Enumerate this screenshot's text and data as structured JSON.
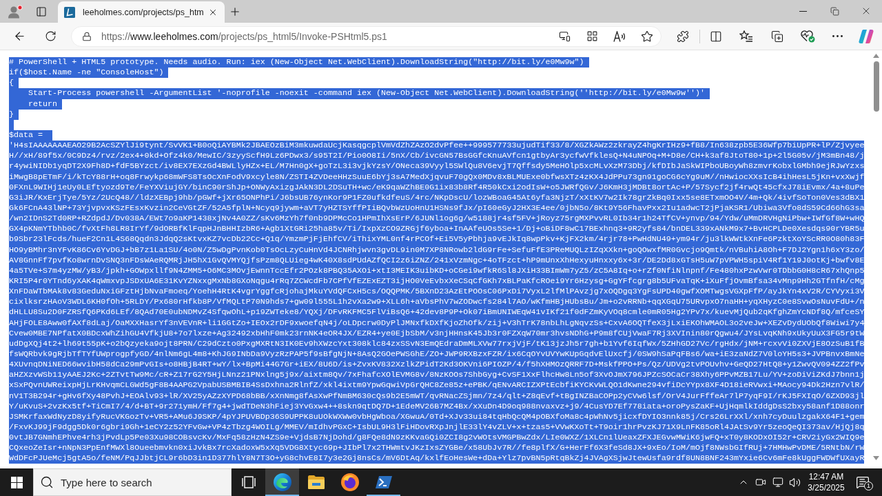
{
  "browser": {
    "tabs": [
      {
        "title": "leeholmes.com/projects/ps_htm",
        "selected": true
      }
    ],
    "address_bar": {
      "scheme": "https://",
      "host": "www.leeholmes.com",
      "path": "/projects/ps_html5/Invoke-PSHtml5.ps1"
    }
  },
  "script": {
    "selected": true,
    "header_lines": [
      "# PowerShell + HTML5 prototype. Needs audio. Run: iex (New-Object Net.WebClient).DownloadString(\"http://bit.ly/e0Mw9w\")",
      "if($host.Name -ne \"ConsoleHost\")",
      "{",
      "    Start-Process powershell -ArgumentList '-noprofile -noexit -command iex (New-Object Net.WebClient).DownloadString(''http://bit.ly/e0Mw9w'')'",
      "    return",
      "}"
    ],
    "assignment": "$data = ",
    "data_lines": [
      "'H4sIAAAAAAAEAO29B2AcSZYlJi9tynt/SvVK1+B0oQiAYBMk2JBAEOzBiM3mkuwdaUcjKasqgcplVmVdZhZAzO2dvPfee++999577733ujudTif33/8/XGZkAWz2zkrayZ4hgKrIHz9+fB8/In638zpb5E36Wfp7biUpPR+lP/Zjvyee",
      "H//xH/89f5x/0C9Dz4/rvz/2ex4+0kd+Ofz4k0/MewIC/3zyyScfH9Lz6PDwx3/s95T2I/Pio0O8Ii/5nX/Cb/ivcGN57BsGGfcKnuAVfcn1gtbyAr3ycfwVfklesQ+N4uNPOq+M+D8e/CH+k3af8JtoT80+1p+2l5G05v/jM3mBn48/j",
      "r4ywiNIDb1yqDT2X9Fh8D+fdF5BYzct/iv8EX7EXzGd4BWLlyHZx+EL/M7Hn0gX+goTzL3i3vjkYzsY/ONeca39Vyyl5SWlQu8V6evjT7Qffsdy5MeHOlp5xcMLvXzM73Dbj/kfDIbJaSkWIPboUBoyWh8zmvrKobxlGMbh9ejRJwYzxs",
      "iMwgB8pETmF/i/kTcY88rH+oq8Frwykp68mWFS8TsOcXnFodV9xcyle8N/ZSTI4ZVDeeHHzSuuE6bYj3sA7MedXjqvuF70gQx0MDv8xBLMUExe0bfwsXTz4zKX4JdPPu73gn91goCG6cYg9uM//nHwiocXXsIcB4ihHesL5jKn+vxXwjf",
      "0FXnL9WIHj1eUy0LEftyozd9Te/FeYXViujGY/binC90rShJp+ONWyAxizgJAkN3DL2DSuTH+wc/eK9qaWZhBE0G1ix83b8Rf4R50kCxi2odIsW+o5JWRfQGv/J6KmH3jMDBt8ortAc+P/57Sycf2jf4rwQt45cfxJ78iEvmx/4a+8uPe",
      "G3iJR/KxErjTye/5Yz/2UcQ48//ldzXEBpj9hb/pGWf+jXr65ONPhPi/J6bsUB76ynKor9P1FZ0ufkdfeuS/4rc/NKpDscU/lozWBoaG45At6yfa3NjzT/xXtKV7w2Ik78grZkBq0Ixx5se8ETxmOO4V/4m+Qk/4ivfSoTon0Ves3dBX1",
      "Gk6FCnA43lNP+73YjvpvxKSzFEsxKvzin2CeVGtZF/52A5fplN+Ncyq9jywm+aVT7yHZTSYffPIiBQvbWzUoHnU1HSNs9fJx/pI60eGyJ2HX3E4ee/0jbN5o/8Kt9Y56FhavPxx2Iu1adwcT2jPjaKSR1/Ubiwa3Vfo8dS59Cd66hG3sa",
      "/wn2IDnS2Td0RP+RZdpdJ/Dv038A/EWt7o9aKP1438xjNv4A0ZZ/sKv6MzYh7f0nb9DPMcCo1HPmIhXsErP/6JUNl1og6g/w5188jr4sf5FV+jRoyz75rgMXPvvRL0Ib34r1h24TfCV+ynvp/94/Ydw/uMmDRVHgNiPbw+IWfGf8W+wHQ",
      "GX4pKNmYTbhb0C/fvXtFh8LR8IrYf/9dORBfKlFqpHJnBHHIzbR6+Agb1XtGRi25ha85v/Ti/IxpXzCO9ZRGjf6yboa+InAAfeUOs5Se+1/Dj+oBiDF8wC17BExhnq3+9R2yfs84/bnDEL339xANkM9x7+BvHCPLDe0Xesdqs90rYBR5u",
      "b9Sbr23lFcds/hueF2Cn1L4S68Qqdn3JdqQ2sKtvxKZ7vcDb22Cc+Q1q/YmzmPjFjEhfCV/iThixYML0nf4rPCOf+Ei5V5yPbhja9vEJkIq8wpPkv+KjFX2km/4rjr78+PwHdNU49+ym94r/ju3lkWWtkXnFe6PzktXoYScRR0O80h83F",
      "HO9yBMhr3nYFvK86Cv6YvDGJ+bB7z1La1SU/4o0N/Z5wDgPvnKob0TsOcLzyCuHnVd4JCNRhjwvn3gvDL9in0M7XP8NRowb2ldG9rFe+SefuFfE3PReMUQLzIZqXXkn+goQOwxfMR0Gvcjo9Qmtk/nVBuhiA8Oh+F7DJ2Ygn1h6xY3zo/",
      "AV8GnnFf7pvfKo8wrnDvSNQ3nFDsWAeRQMRjJH5hX1GvQVMYQjfsPzm8QLUieg4wK40X8sdPUdAZfQCI2z6iZNZ/241xVzmNgc+4oTFzct+hP9mUnxXhHexyuHnxxy6x+3r/DE2Dd8xGTsH5uW7pVPWH5spiV4Rf1Y19J0otKj+bwfv8E",
      "4a5TVe+S7m4yzMW/yB3/jpkh+GOWpxllf9N4ZMM5+O6MC3MOvjEwnnTccEfr2POzk8PBQ35AXOi+xtI3MEIK3uibKD+oCGei9wfkR6Sl8JXiH33BImWm7yZ5/zC5A8Iq+o+rZf0NfiNlnpnf/Fe480hxPzwVwr0TDbbG0H8cR67xhQnp5",
      "KRI5P4r0YTnd6yXAK4qWmxvpJSDxUA6E31KvYZNxxgMxNb8GXoNqgu4rRq7ZCWcdFb7CPfVfEZExEZT3ijHO0VeEvbxXeCSqCfGKh7xBLPaKfcROei9Yr6Hzysg+GgYFfcgrg8b5UFvaTqK+iXuFfjOvmBfsa34vMnp9Hh2GTfnfH/cMg",
      "XnFDaWTbMAk8v83GeduNxiGFztHjbNvaFmoeq/YoehH4RtK4vgrYggfcRjohajMkuYVdQFCxH5cs/OQQPMK/5BXnD23AzEtPOOsC06PxDi7VyxL2lfMlPAvzjg7xOQDgq3YgFsUPD40gwfXOMTwgsVGXpFfP/ayJkYn4xV2R/CYVyxi3V",
      "cixlksrzHAoV3WDL6KH0fOh+5RLDY/Px680rHfkb8P/VfMQLtP70N9hds7+gw09l555L1h2vXa2w9+XLL6h+aVbsPhV7wZODwcfs284l7AO/wKfmHBjHUbsBu/Jm+o2vRRNb+qqXGqU75URvpxO7naHH+yqXHyzC0e8SvwOsNuvFdU+/n",
      "dHLLU8Su2D0FZRSfQ6PKd6LEf/8QAd70E0ubNDMvZ4SfqwOhL+p19ZWTeke8/YQXj/DFvRKFMC5FlViBsQ6+42dev8P9P+Ok07iBmUNIWEqW41vIKf21f0dFZmKyVOq8cmle0mR05Hg2YPv7x/kuevMjQub2qKfghZmYcNDf8Q/mfceSY",
      "AHjFOLE8Aww0fAXf8dLaj/OaMXXHasrYf3nVEVnR+li1GGtZo+IEOx2rDF9xwoefqN4j/oLDpcrw0DyPlJMNxfkDXfKjoZhOfk/zij+V3hTrK78nbLhLgNqvzSs+CxvA6OQTfeX3jLxiEKOhWMAOL3o2veJw+XEZvDydUObQf8Wiwi7y4",
      "Cvew0MBE7NPfatX0BDcxWhZihGU4VfkjU8+7o7lxze+Ag32492xbHhF0mk23rnNK4eOR4JX/EZR4+ye0EjbSbM/v3njHHnsK45Jb3r0FZXqW70mr3hvsNDhG+P9m8fCUjVwaF7Rj3XVInin80rQgwu4/JYsLvqKNh9xUkyUuX3FG5r9tW",
      "udDgXQj4t2+lh69t55pK+o2bQzyeka9ojt8PRN/C29dCzto0PxgMXRtN3IK0Ev9hXWzcYxt308klc84zxSSvN3EmQEdraDmMLXVw77rxjVjF/tK13jzJh5r7gh+b1Yvf6IqfWx/5ZHhGD27Vc/rgHdx/jNM+rcxvVi0ZXVjE8OzSuB1fB",
      "fsWQRbvk9gRjbTfTYfUWprogpfyGD/4nlNm6gL4m8+KhJG9INbDa9VyzRzPAP5f9sBfgNjN+8AsQ2GOePWSGhE/ZO+JWP9RXBzxFZR/ix6CqOYvUVYwKUpGqdvElUxcfj/0SW9hSaPqFBs6/wa+iE3zaNdZ7V0loYH5s3+JVPBnvxBmNe",
      "4XUvnqDNiNED66wvibH58dCa29mPvGIs+o8HBjB4RT+wY/lx+BpMi44G7Gr+iEX/8U6D/is+ZvxKV832XzlkZPidT2Kd3OKVni6PIOZP/4/f5hXHMOzQRRF7D+MskfPPO+Ps/Qz/UDVg2tvPOUvhv+GeQD27HtQ8+y1ZwvQV094ZZ2fPv",
      "aHZXzvWSb11yAAEJ2Kc+2ZTvtTw9Mc/cR+Z17rG2Y5HjLNnz21PNxlng5j9x/aixtm8Qv/7xFhafcXOlEVMG8v/8NzKOOs7ShbGyg+CvSF1XxFlhcHw8Ln5of3XvOJmX796JPZcSOCaCr38Xhy6PPvMZB17Lu/YV+zoDiViZKdJ7bnn1j",
      "xSxPQvnUWReixpHjLrKHvqmCLGWd5gF8B4AAPG2VpabUSBMBIB4SsDxhna2RlnfZ/xkl4ixtm9YpwGqwiVpGrQHC8Ze85z+ePBK/qENvARCIZXPtEcbfiKYCKvWLQO1dKwne294vfiDcYYpx8XF4D18ieRVwxi+MAocy94Dk2Hzn7vlR/",
      "nV1T3B294r+gHv6fXy48PvhJ+EOAlv93+lR/XV25yAZzXYPD68bBB/xXnNmg8fAsXwPfNmBM630cQs9b2E5mWT/qvRNacZSjmn/7z4/qlt+Z8qEvf+tBgINZBaCOPp2yCVw6lsf/OrV4JurFffeAr7lP7yqF9I/rKJ5FXIqO/6ZXD93jl",
      "Y/uKvuS+2vzKx5tf+TiCmI7/4/d+BT+9r271ymH/Ff7g4+jwdTDeN3hFiej3YvGxw4++8skn9qtDQ7D+1EdeMV26B7MZ4Bx/xXuDn4D9oq988nvaxvz+j9/4CusYD7Ef778iata+oroPysZaKF+UjHqmlkIddgDsS2bxy58anf1D88onr",
      "JSMKrfaxWdNyzD8yifyRucVKGozTv+VR5+AMu6J9SKP/4pYJPUVBDp36S9UPPK8uUOkWXWw0vbHgWboa/XGwuA/0Td+XJv33ui84tqHbQcQM4pOBXfoMa8c4pWhNv5jicxfDYIO3nnk85j/Crs26LrXXl/xnh7cyDuulzgakX64F1+gem",
      "/FxvKJ99jF9dgg5Dk0r6gbri9Gh+1eCY2z52YFvGw+VP4zTbzg4WOILg/MMEV/mIdhvPGxC+IsbUL9H3lFiHDovRXpJnjlE33lY4vZLV+x+tzas5+VVwKXoTt+T9oir1hrPvzKJ71X9LnFK85oRl4JAtSv9Yr5zeoQeQI373av/HjQj8q",
      "0vtJB7GNmhEPhve4rh3jPvdLp5Pe03Xu98COBsvcKv/MxFq58zHzN4ZS9e+VjdsB7NjDohd/g8FQe8dN9zKKvaGQi0ZCI8g2vWOtsVMGPBwZdx/LIe0WXZ/1XLCn1lUeaxZFXJEGvwMWiK6jwFQ+xT0y8KODxOI52r+CRV2iyGx2WIQ9e",
      "CQxeoZeIsr+nNpN3PpEnfMWXl8Oueebmvkn0xiJvkBx7rcXadoxW5xXq5VDG8Xtyc69p+JIbPl7x2THWmtvJKzIxsZYGBe/x58UbJv7R//fe8plfX/G+HerFf6X3feSd8JX+9xEo/IoM/mOjf8NWsbGIfRUj+7HMHwPvDME/5RNtbN/rW",
      "WdDFcPJUeMcj5gtA5o/feNM/PqJJbtjCL9r6bD3in1D377hlY8N7T3O+yG8chvE8I7y3e2Gj8nsCs/mV6DtAq/kxlfEoHesWe+dDa+Ylz7pvBN5pRtqBkZj4JVAgXSjwJtewUsfa9rdf8UN8BNF243mYxie6Cv6mFe8kUggFWDWfUXayR"
    ]
  },
  "taskbar": {
    "search": {
      "placeholder": "Type here to search"
    },
    "apps": [
      {
        "kind": "task_view",
        "active": false,
        "running": false
      },
      {
        "kind": "edge",
        "active": true,
        "running": true
      },
      {
        "kind": "file_explorer",
        "active": false,
        "running": false
      },
      {
        "kind": "firefox",
        "active": false,
        "running": false
      },
      {
        "kind": "powershell",
        "active": false,
        "running": true
      }
    ],
    "clock": {
      "time": "12:47 AM",
      "date": "3/25/2025"
    },
    "notifications": {
      "count": "1"
    }
  }
}
